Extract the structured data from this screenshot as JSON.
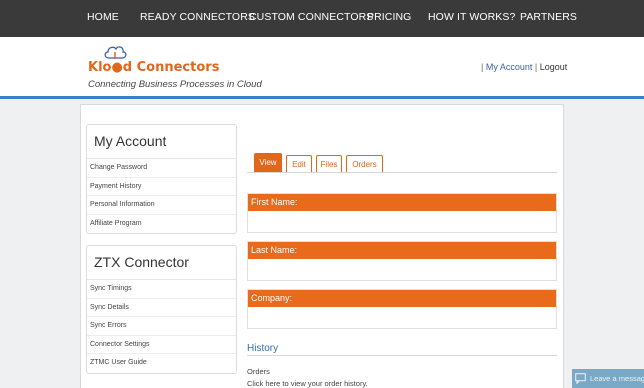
{
  "nav": {
    "items": [
      "HOME",
      "READY CONNECTORS",
      "CUSTOM CONNECTORS",
      "PRICING",
      "HOW IT WORKS?",
      "PARTNERS"
    ]
  },
  "header": {
    "logo_text": "Klo●d Connectors",
    "tagline": "Connecting Business Processes in Cloud",
    "my_account": "My Account",
    "separator": "|",
    "logout": "Logout"
  },
  "sidebar": {
    "account": {
      "title": "My Account",
      "items": [
        "Change Password",
        "Payment History",
        "Personal Information",
        "Affiliate Program"
      ]
    },
    "ztx": {
      "title": "ZTX Connector",
      "items": [
        "Sync Timings",
        "Sync Details",
        "Sync Errors",
        "Connector Settings",
        "ZTMC User Guide"
      ]
    }
  },
  "tabs": {
    "items": [
      "View",
      "Edit",
      "Files",
      "Orders"
    ],
    "active": "View"
  },
  "profile": {
    "first_name_label": "First Name:",
    "first_name_value": "",
    "last_name_label": "Last Name:",
    "last_name_value": "",
    "company_label": "Company:",
    "company_value": ""
  },
  "history": {
    "title": "History",
    "orders_label": "Orders",
    "orders_link": "Click here to view your order history."
  },
  "chat": {
    "label": "Leave a message"
  },
  "colors": {
    "accent_orange": "#e96a1b",
    "nav_bg": "#3a3a3a",
    "brand_blue": "#3d7ec9"
  }
}
